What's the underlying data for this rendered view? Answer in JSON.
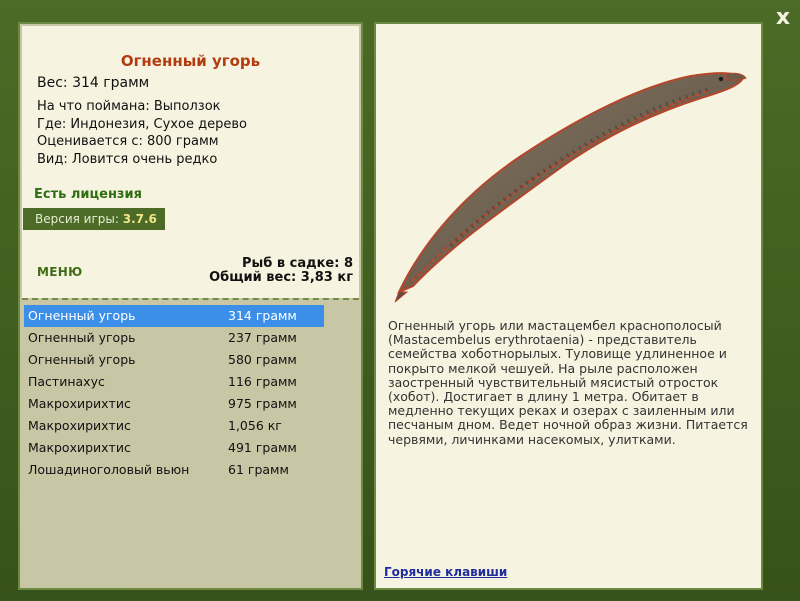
{
  "fish": {
    "title": "Огненный угорь",
    "weight": "Вес: 314 грамм",
    "caught_with": "На что поймана: Выползок",
    "where": "Где: Индонезия, Сухое дерево",
    "valued_from": "Оценивается с: 800 грамм",
    "rarity": "Вид: Ловится очень редко"
  },
  "license": "Есть лицензия",
  "version": {
    "label": "Версия игры:",
    "value": "3.7.6"
  },
  "menu_label": "МЕНЮ",
  "stats": {
    "count": "Рыб в садке: 8",
    "total": "Общий вес: 3,83 кг"
  },
  "catch_list": [
    {
      "name": "Огненный угорь",
      "weight": "314 грамм"
    },
    {
      "name": "Огненный угорь",
      "weight": "237 грамм"
    },
    {
      "name": "Огненный угорь",
      "weight": "580 грамм"
    },
    {
      "name": "Пастинахус",
      "weight": "116 грамм"
    },
    {
      "name": "Макрохирихтис",
      "weight": "975 грамм"
    },
    {
      "name": "Макрохирихтис",
      "weight": "1,056 кг"
    },
    {
      "name": "Макрохирихтис",
      "weight": "491 грамм"
    },
    {
      "name": "Лошадиноголовый вьюн",
      "weight": "61 грамм"
    }
  ],
  "description": "Огненный угорь или мастацембел краснополосый (Mastacembelus erythrotaenia) - представитель семейства хоботнорылых. Туловище удлиненное и покрыто мелкой чешуей. На рыле расположен заостренный чувствительный мясистый отросток (хобот). Достигает в длину 1 метра. Обитает в медленно текущих реках и озерах с заиленным или песчаным дном. Ведет ночной образ жизни. Питается червями, личинками насекомых, улитками.",
  "hotkeys_label": "Горячие клавиши",
  "close_label": "x",
  "icons": {
    "close": "close-icon",
    "fish_picture": "eel-picture"
  },
  "colors": {
    "frame": "#4b6b26",
    "panel": "#f6f4e0",
    "list_bg": "#c9c6a5",
    "title": "#b23c10",
    "license": "#2e6e12",
    "selected": "#3b8fe8",
    "link": "#1f2e9c"
  }
}
